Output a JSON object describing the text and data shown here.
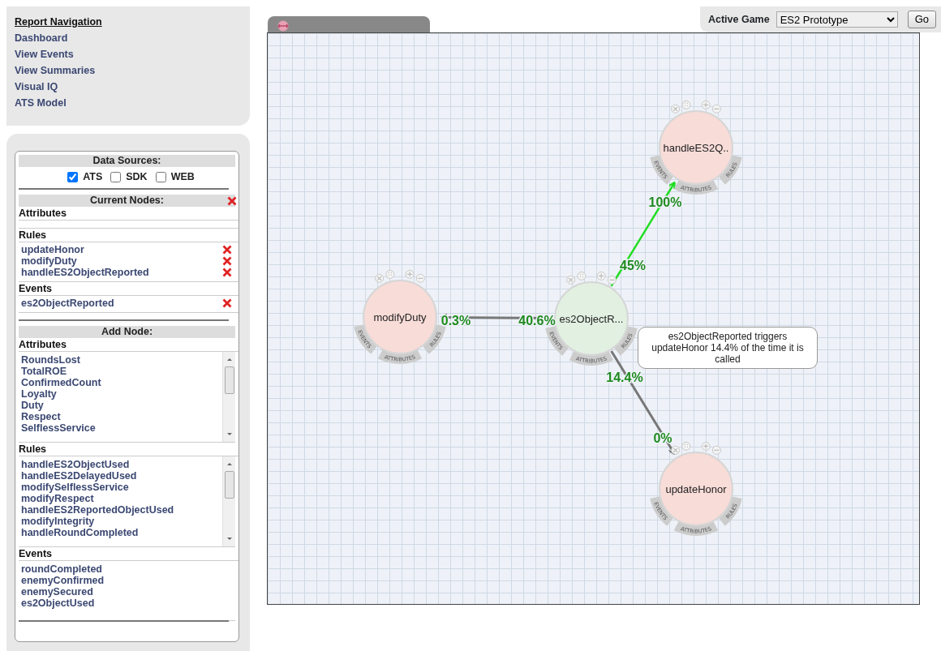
{
  "navigation": {
    "title": "Report Navigation",
    "links": [
      "Dashboard",
      "View Events",
      "View Summaries",
      "Visual IQ",
      "ATS Model"
    ]
  },
  "sidebar": {
    "data_sources": {
      "title": "Data Sources:",
      "options": [
        {
          "label": "ATS",
          "checked": true
        },
        {
          "label": "SDK",
          "checked": false
        },
        {
          "label": "WEB",
          "checked": false
        }
      ]
    },
    "current_nodes": {
      "title": "Current Nodes:",
      "sections": [
        {
          "title": "Attributes"
        },
        {
          "title": "Rules",
          "items": [
            "updateHonor",
            "modifyDuty",
            "handleES2ObjectReported"
          ]
        },
        {
          "title": "Events",
          "items": [
            "es2ObjectReported"
          ]
        }
      ]
    },
    "add_node": {
      "title": "Add Node:",
      "sections": [
        {
          "title": "Attributes",
          "items": [
            "RoundsLost",
            "TotalROE",
            "ConfirmedCount",
            "Loyalty",
            "Duty",
            "Respect",
            "SelflessService"
          ]
        },
        {
          "title": "Rules",
          "items": [
            "handleES2ObjectUsed",
            "handleES2DelayedUsed",
            "modifySelflessService",
            "modifyRespect",
            "handleES2ReportedObjectUsed",
            "modifyIntegrity",
            "handleRoundCompleted"
          ]
        },
        {
          "title": "Events",
          "items": [
            "roundCompleted",
            "enemyConfirmed",
            "enemySecured",
            "es2ObjectUsed"
          ]
        }
      ]
    }
  },
  "game_selector": {
    "label": "Active Game",
    "value": "ES2 Prototype",
    "button": "Go"
  },
  "graph": {
    "nodes": [
      {
        "label": "handleES2Q..",
        "kind": "rule",
        "ring": [
          "EVENTS",
          "ATTRIBUTES",
          "RULES"
        ]
      },
      {
        "label": "modifyDuty",
        "kind": "rule",
        "ring": [
          "EVENTS",
          "ATTRIBUTES",
          "RULES"
        ]
      },
      {
        "label": "es2ObjectR...",
        "kind": "event",
        "ring": [
          "EVENTS",
          "ATTRIBUTES",
          "RULES"
        ]
      },
      {
        "label": "updateHonor",
        "kind": "rule",
        "ring": [
          "EVENTS",
          "ATTRIBUTES",
          "RULES"
        ]
      }
    ],
    "edges": [
      {
        "source_label": "45%",
        "target_label": "100%",
        "selected": true
      },
      {
        "source_label": "40.6%",
        "target_label": "0.3%",
        "selected": false
      },
      {
        "source_label": "14.4%",
        "target_label": "0%",
        "selected": false
      }
    ],
    "tooltip": "es2ObjectReported triggers updateHonor 14.4% of the time it is called"
  }
}
